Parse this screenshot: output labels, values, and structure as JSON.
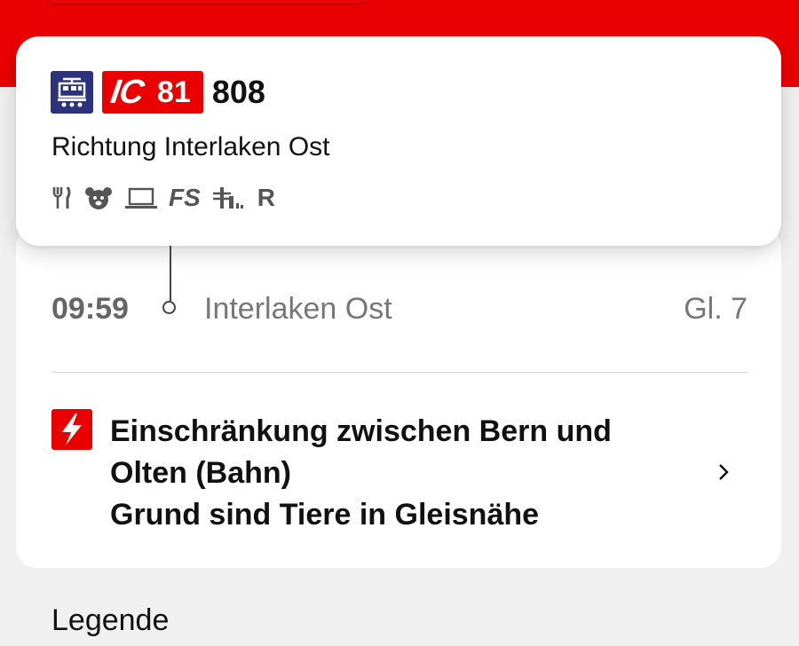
{
  "train": {
    "category": "IC",
    "line": "81",
    "number": "808",
    "direction": "Richtung Interlaken Ost",
    "amenities": [
      "restaurant-icon",
      "family-zone-icon",
      "business-zone-icon",
      "FS",
      "low-floor-access-icon",
      "R"
    ]
  },
  "stop": {
    "time": "09:59",
    "name": "Interlaken Ost",
    "platform": "Gl. 7"
  },
  "notice": {
    "lines": [
      "Einschränkung zwischen Bern und",
      "Olten (Bahn)",
      "Grund sind Tiere in Gleisnähe"
    ]
  },
  "legend": {
    "label": "Legende"
  },
  "colors": {
    "accent": "#eb0000",
    "train_icon_bg": "#2d327d",
    "card_bg": "#ffffff",
    "page_bg": "#f0f0f0"
  }
}
